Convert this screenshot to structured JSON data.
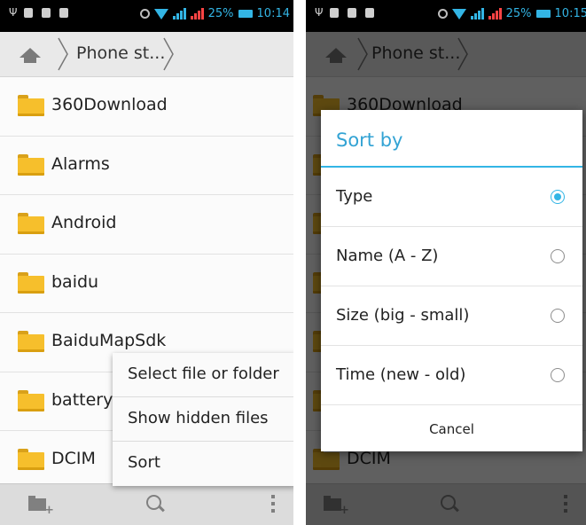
{
  "status_bar": {
    "battery": "25%",
    "time": "10:14",
    "time_right": "10:15"
  },
  "breadcrumb": {
    "path": "Phone st..."
  },
  "files": [
    "360Download",
    "Alarms",
    "Android",
    "baidu",
    "BaiduMapSdk",
    "batteryl",
    "DCIM"
  ],
  "popup_menu": {
    "items": [
      "Select file or folder",
      "Show hidden files",
      "Sort"
    ]
  },
  "sort_dialog": {
    "title": "Sort by",
    "options": [
      {
        "label": "Type",
        "selected": true
      },
      {
        "label": "Name (A - Z)",
        "selected": false
      },
      {
        "label": "Size (big - small)",
        "selected": false
      },
      {
        "label": "Time (new - old)",
        "selected": false
      }
    ],
    "cancel_label": "Cancel"
  },
  "colors": {
    "accent": "#33b5e5",
    "folder": "#f6bf2c"
  },
  "icons": [
    "home-icon",
    "folder-icon",
    "new-folder-icon",
    "search-icon",
    "more-vert-icon",
    "wifi-icon",
    "battery-icon",
    "alarm-icon"
  ]
}
